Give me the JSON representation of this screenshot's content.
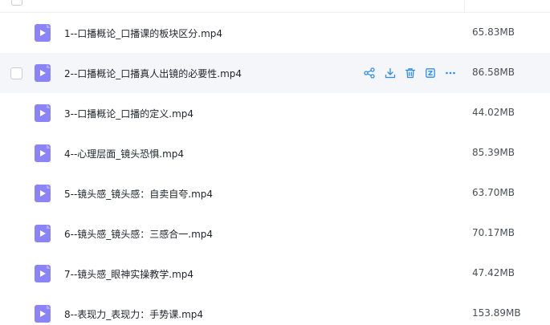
{
  "colors": {
    "accent": "#2d8cf0",
    "file_icon": "#8b84f8",
    "hover_row": "#f5f6fa"
  },
  "row_actions": [
    {
      "icon": "share-icon"
    },
    {
      "icon": "download-icon"
    },
    {
      "icon": "delete-icon"
    },
    {
      "icon": "rename-icon"
    },
    {
      "icon": "more-icon"
    }
  ],
  "files": [
    {
      "name": "1--口播概论_口播课的板块区分.mp4",
      "size": "65.83MB",
      "icon": "video-file-icon"
    },
    {
      "name": "2--口播概论_口播真人出镜的必要性.mp4",
      "size": "86.58MB",
      "icon": "video-file-icon"
    },
    {
      "name": "3--口播概论_口播的定义.mp4",
      "size": "44.02MB",
      "icon": "video-file-icon"
    },
    {
      "name": "4--心理层面_镜头恐惧.mp4",
      "size": "85.39MB",
      "icon": "video-file-icon"
    },
    {
      "name": "5--镜头感_镜头感：自卖自夸.mp4",
      "size": "63.70MB",
      "icon": "video-file-icon"
    },
    {
      "name": "6--镜头感_镜头感：三感合一.mp4",
      "size": "70.17MB",
      "icon": "video-file-icon"
    },
    {
      "name": "7--镜头感_眼神实操教学.mp4",
      "size": "47.42MB",
      "icon": "video-file-icon"
    },
    {
      "name": "8--表现力_表现力：手势课.mp4",
      "size": "153.89MB",
      "icon": "video-file-icon"
    }
  ]
}
